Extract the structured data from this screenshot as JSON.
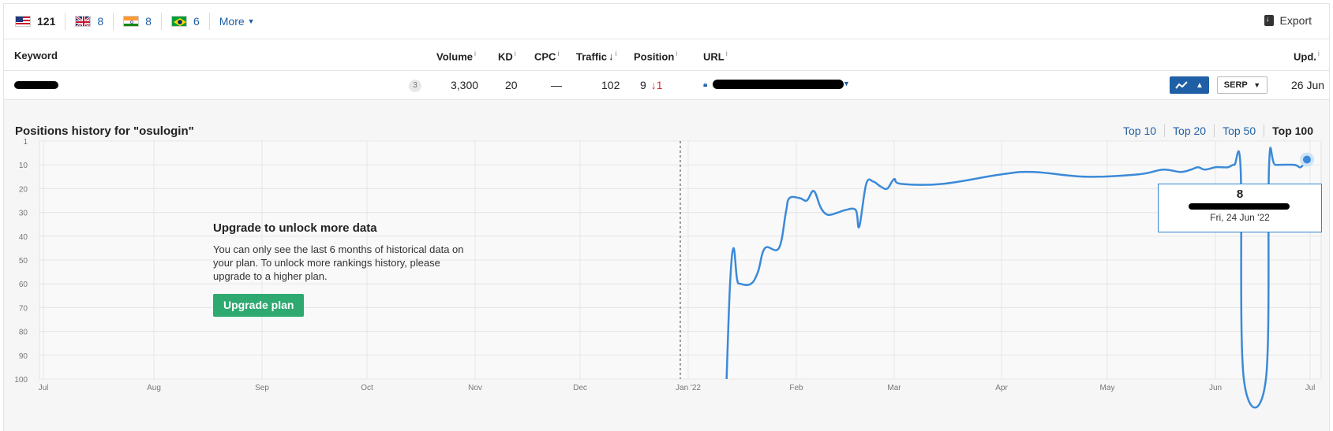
{
  "countries": [
    {
      "flag": "us",
      "count": "121",
      "active": true
    },
    {
      "flag": "uk",
      "count": "8",
      "active": false
    },
    {
      "flag": "in",
      "count": "8",
      "active": false
    },
    {
      "flag": "br",
      "count": "6",
      "active": false
    }
  ],
  "more_label": "More",
  "export_label": "Export",
  "columns": {
    "keyword": "Keyword",
    "volume": "Volume",
    "kd": "KD",
    "cpc": "CPC",
    "traffic": "Traffic",
    "position": "Position",
    "url": "URL",
    "upd": "Upd.",
    "info_mark": "i",
    "sort_arrow": "↓"
  },
  "row": {
    "serp_features_count": "3",
    "volume": "3,300",
    "kd": "20",
    "cpc": "—",
    "traffic": "102",
    "position": "9",
    "position_change": "↓1",
    "serp_button": "SERP",
    "updated": "26 Jun"
  },
  "history": {
    "title": "Positions history for \"osulogin\"",
    "top_links": [
      "Top 10",
      "Top 20",
      "Top 50",
      "Top 100"
    ],
    "active_top": "Top 100"
  },
  "upgrade": {
    "heading": "Upgrade to unlock more data",
    "body": "You can only see the last 6 months of historical data on your plan. To unlock more rankings history, please upgrade to a higher plan.",
    "button": "Upgrade plan"
  },
  "tooltip": {
    "position": "8",
    "date": "Fri, 24 Jun '22"
  },
  "colors": {
    "line": "#3b8ad8",
    "link": "#1f5fa6",
    "upgrade_button": "#2ea96f",
    "decline": "#d0312d"
  },
  "chart_data": {
    "type": "line",
    "y_reversed": true,
    "ylim": [
      1,
      100
    ],
    "y_ticks": [
      "1",
      "10",
      "20",
      "30",
      "40",
      "50",
      "60",
      "70",
      "80",
      "90",
      "100"
    ],
    "x_ticks": [
      "Jul",
      "Aug",
      "Sep",
      "Oct",
      "Nov",
      "Dec",
      "Jan '22",
      "Feb",
      "Mar",
      "Apr",
      "May",
      "Jun",
      "Jul"
    ],
    "series": [
      {
        "points": [
          [
            "Jan 12",
            100
          ],
          [
            "Jan 13",
            60
          ],
          [
            "Jan 14",
            45
          ],
          [
            "Jan 15",
            58
          ],
          [
            "Jan 16",
            60
          ],
          [
            "Jan 19",
            60
          ],
          [
            "Jan 21",
            55
          ],
          [
            "Jan 23",
            45
          ],
          [
            "Jan 27",
            45
          ],
          [
            "Jan 29",
            30
          ],
          [
            "Jan 30",
            24
          ],
          [
            "Feb 2",
            24
          ],
          [
            "Feb 4",
            25
          ],
          [
            "Feb 6",
            21
          ],
          [
            "Feb 8",
            28
          ],
          [
            "Feb 10",
            31
          ],
          [
            "Feb 13",
            30
          ],
          [
            "Feb 15",
            29
          ],
          [
            "Feb 18",
            29
          ],
          [
            "Feb 19",
            36
          ],
          [
            "Feb 21",
            18
          ],
          [
            "Feb 23",
            17
          ],
          [
            "Feb 25",
            19
          ],
          [
            "Feb 27",
            20
          ],
          [
            "Mar 1",
            16
          ],
          [
            "Mar 3",
            18
          ],
          [
            "Mar 15",
            18
          ],
          [
            "Apr 1",
            14
          ],
          [
            "Apr 10",
            13
          ],
          [
            "Apr 25",
            15
          ],
          [
            "May 10",
            14
          ],
          [
            "May 17",
            12
          ],
          [
            "May 22",
            13
          ],
          [
            "May 25",
            12
          ],
          [
            "May 27",
            11
          ],
          [
            "May 29",
            12
          ],
          [
            "Jun 1",
            11
          ],
          [
            "Jun 3",
            11
          ],
          [
            "Jun 5",
            11
          ],
          [
            "Jun 7",
            10
          ],
          [
            "Jun 9",
            12
          ],
          [
            "Jun 10",
            100
          ],
          [
            "Jun 17",
            100
          ],
          [
            "Jun 18",
            10
          ],
          [
            "Jun 20",
            10
          ],
          [
            "Jun 26",
            10
          ],
          [
            "Jun 28",
            11
          ],
          [
            "Jun 30",
            8
          ]
        ]
      }
    ],
    "grid": true
  }
}
